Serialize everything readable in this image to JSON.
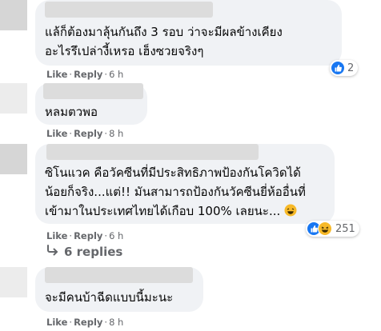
{
  "comments": [
    {
      "lines": [
        "แล้ก็ต้องมาลุ้นกันถึง 3 รอบ ว่าจะมีผลข้างเคียง",
        "อะไรรึเปล่างี้เหรอ เฮ็งซวยจริงๆ"
      ],
      "like_label": "Like",
      "reply_label": "Reply",
      "time": "6 h",
      "reaction_count": "2"
    },
    {
      "lines": [
        "หลมตวพอ"
      ],
      "like_label": "Like",
      "reply_label": "Reply",
      "time": "8 h"
    },
    {
      "lines": [
        "ซิโนแวค คือวัคซีนที่มีประสิทธิภาพป้องกันโควิดได้",
        "น้อยก็จริง...แต่!! มันสามารถป้องกันวัคซีนยี่ห้ออื่นที่",
        "เข้ามาในประเทศไทยได้เกือบ 100% เลยนะ..."
      ],
      "like_label": "Like",
      "reply_label": "Reply",
      "time": "6 h",
      "reaction_count": "251"
    },
    {
      "lines": [
        "จะมีคนบ้าฉีดแบบนี้มะนะ"
      ],
      "like_label": "Like",
      "reply_label": "Reply",
      "time": "8 h"
    }
  ],
  "replies_link": "6 replies",
  "colors": {
    "bubble": "#f0f2f5",
    "meta": "#65676b",
    "like_blue": "#1877f2",
    "haha_yellow": "#f7b928"
  },
  "icons": [
    "like-reaction-icon",
    "haha-reaction-icon",
    "reply-arrow-icon"
  ]
}
